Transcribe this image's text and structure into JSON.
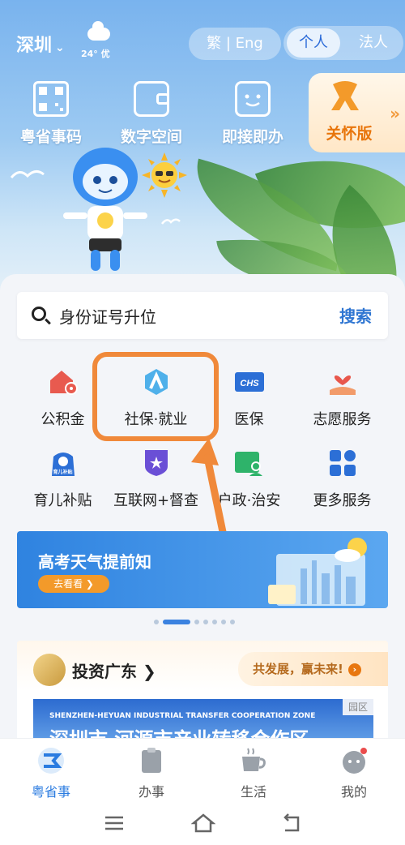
{
  "header": {
    "city": "深圳",
    "weather": "24° 优",
    "language_toggle": "繁 | Eng",
    "roles": [
      "个人",
      "法人"
    ]
  },
  "quick_actions": [
    {
      "label": "粤省事码",
      "icon": "qr-code-icon"
    },
    {
      "label": "数字空间",
      "icon": "wallet-icon"
    },
    {
      "label": "即接即办",
      "icon": "chat-icon"
    }
  ],
  "care_mode": {
    "label": "关怀版",
    "icon": "ribbon-icon"
  },
  "search": {
    "placeholder": "身份证号升位",
    "button": "搜索"
  },
  "services": [
    {
      "label": "公积金",
      "icon": "house-fund-icon"
    },
    {
      "label": "社保·就业",
      "icon": "social-security-icon"
    },
    {
      "label": "医保",
      "icon": "chs-icon"
    },
    {
      "label": "志愿服务",
      "icon": "volunteer-heart-icon"
    },
    {
      "label": "育儿补贴",
      "icon": "childcare-subsidy-icon",
      "badge": "育儿补贴"
    },
    {
      "label": "互联网+督查",
      "icon": "shield-star-icon"
    },
    {
      "label": "户政·治安",
      "icon": "household-icon"
    },
    {
      "label": "更多服务",
      "icon": "grid-icon"
    }
  ],
  "banner": {
    "title": "高考天气提前知",
    "button": "去看看 ❯"
  },
  "invest": {
    "title": "投资广东 ❯",
    "slogan": "共发展，赢未来!",
    "tag": "园区",
    "image_en": "SHENZHEN-HEYUAN INDUSTRIAL TRANSFER COOPERATION ZONE",
    "image_cn": "深圳市 河源市产业转移合作区"
  },
  "tabs": [
    {
      "label": "粤省事",
      "icon": "home-brand-icon",
      "active": true
    },
    {
      "label": "办事",
      "icon": "clipboard-icon",
      "active": false
    },
    {
      "label": "生活",
      "icon": "coffee-cup-icon",
      "active": false
    },
    {
      "label": "我的",
      "icon": "profile-icon",
      "active": false
    }
  ],
  "colors": {
    "accent": "#2f76d2",
    "highlight": "#f0893a",
    "care": "#e8750b"
  }
}
